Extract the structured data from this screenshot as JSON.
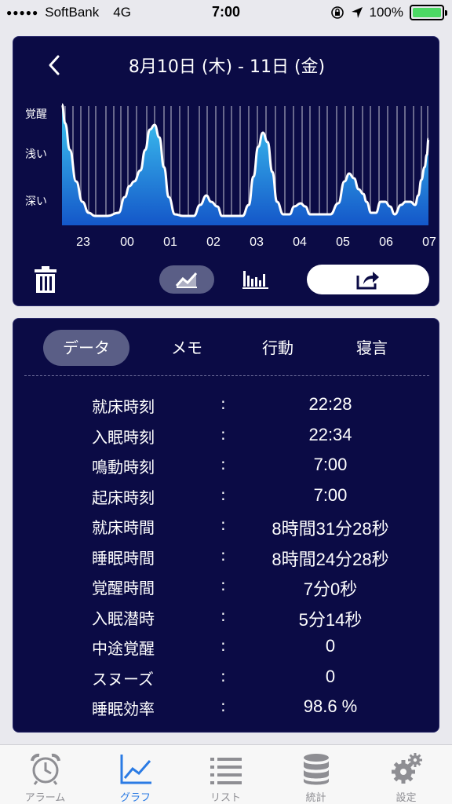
{
  "status_bar": {
    "carrier": "SoftBank",
    "network": "4G",
    "time": "7:00",
    "battery": "100%"
  },
  "header": {
    "title": "8月10日 (木) - 11日 (金)"
  },
  "chart_data": {
    "type": "area",
    "y_levels": [
      "覚醒",
      "浅い",
      "深い"
    ],
    "x_ticks": [
      "23",
      "00",
      "01",
      "02",
      "03",
      "04",
      "05",
      "06",
      "07"
    ],
    "color": "#1ea6e8"
  },
  "tabs": [
    {
      "label": "データ",
      "active": true
    },
    {
      "label": "メモ",
      "active": false
    },
    {
      "label": "行動",
      "active": false
    },
    {
      "label": "寝言",
      "active": false
    }
  ],
  "rows": [
    {
      "label": "就床時刻",
      "colon": ":",
      "value": "22:28"
    },
    {
      "label": "入眠時刻",
      "colon": ":",
      "value": "22:34"
    },
    {
      "label": "鳴動時刻",
      "colon": ":",
      "value": "7:00"
    },
    {
      "label": "起床時刻",
      "colon": ":",
      "value": "7:00"
    },
    {
      "label": "就床時間",
      "colon": ":",
      "value": "8時間31分28秒"
    },
    {
      "label": "睡眠時間",
      "colon": ":",
      "value": "8時間24分28秒"
    },
    {
      "label": "覚醒時間",
      "colon": ":",
      "value": "7分0秒"
    },
    {
      "label": "入眠潜時",
      "colon": ":",
      "value": "5分14秒"
    },
    {
      "label": "中途覚醒",
      "colon": ":",
      "value": "0"
    },
    {
      "label": "スヌーズ",
      "colon": ":",
      "value": "0"
    },
    {
      "label": "睡眠効率",
      "colon": ":",
      "value": "98.6 %"
    }
  ],
  "tabbar": [
    {
      "label": "アラーム",
      "icon": "alarm-clock-icon",
      "active": false
    },
    {
      "label": "グラフ",
      "icon": "graph-icon",
      "active": true
    },
    {
      "label": "リスト",
      "icon": "list-icon",
      "active": false
    },
    {
      "label": "統計",
      "icon": "database-icon",
      "active": false
    },
    {
      "label": "設定",
      "icon": "gear-icon",
      "active": false
    }
  ]
}
